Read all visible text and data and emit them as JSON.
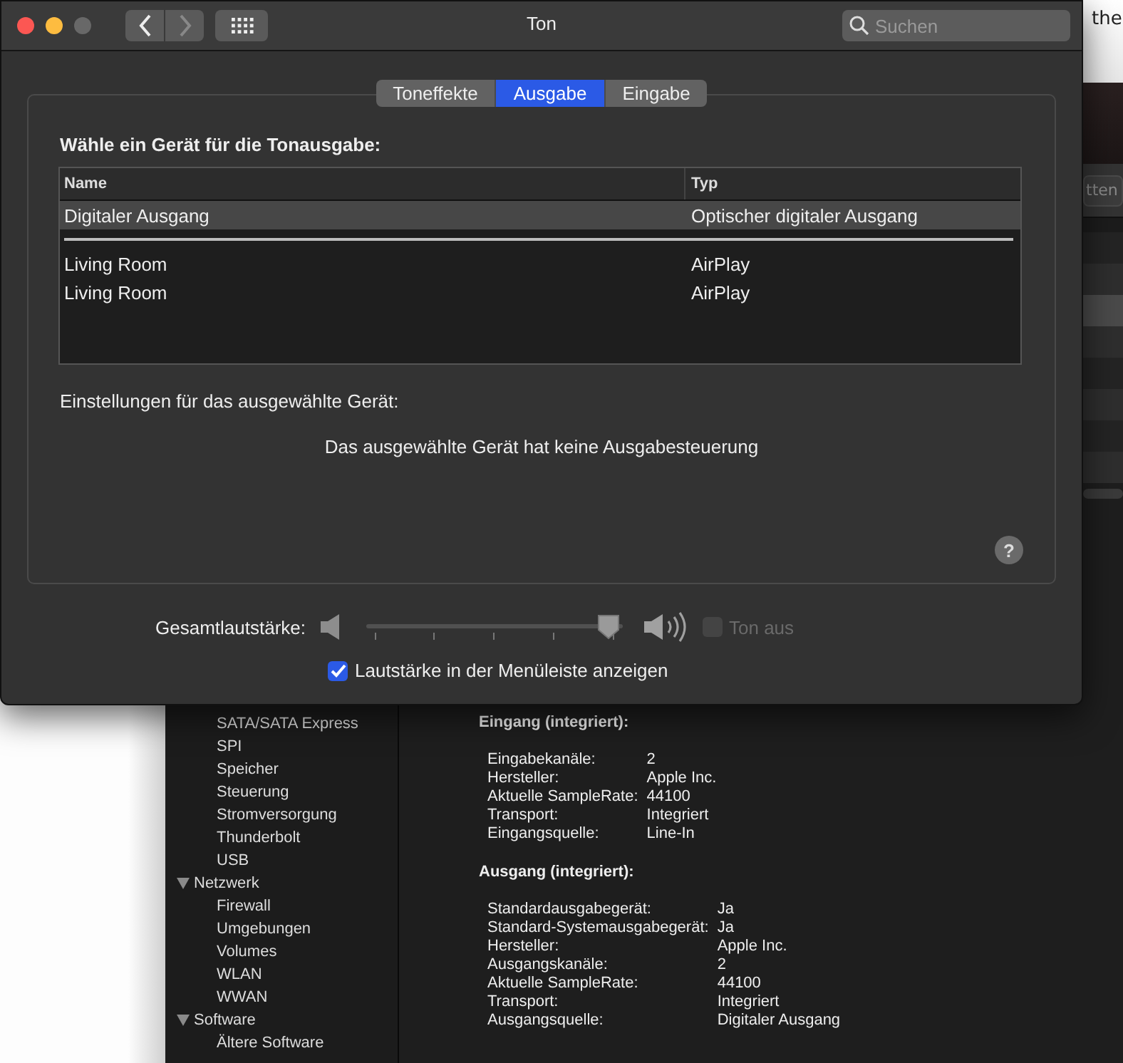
{
  "other_window": {
    "text": "the"
  },
  "background_window": {
    "toolbar_button": "tten",
    "sidebar": {
      "continued_items": [
        "SATA/SATA Express",
        "SPI",
        "Speicher",
        "Steuerung",
        "Stromversorgung",
        "Thunderbolt",
        "USB"
      ],
      "items": [
        {
          "label": "Netzwerk",
          "expanded": true,
          "children": [
            "Firewall",
            "Umgebungen",
            "Volumes",
            "WLAN",
            "WWAN"
          ]
        },
        {
          "label": "Software",
          "expanded": true,
          "children": [
            "Ältere Software"
          ]
        }
      ]
    },
    "details": [
      {
        "title": "Eingang (integriert):",
        "rows": [
          {
            "key": "Eingabekanäle:",
            "value": "2"
          },
          {
            "key": "Hersteller:",
            "value": "Apple Inc."
          },
          {
            "key": "Aktuelle SampleRate:",
            "value": "44100"
          },
          {
            "key": "Transport:",
            "value": "Integriert"
          },
          {
            "key": "Eingangsquelle:",
            "value": "Line-In"
          }
        ]
      },
      {
        "title": "Ausgang (integriert):",
        "rows": [
          {
            "key": "Standardausgabegerät:",
            "value": "Ja"
          },
          {
            "key": "Standard-Systemausgabegerät:",
            "value": "Ja"
          },
          {
            "key": "Hersteller:",
            "value": "Apple Inc."
          },
          {
            "key": "Ausgangskanäle:",
            "value": "2"
          },
          {
            "key": "Aktuelle SampleRate:",
            "value": "44100"
          },
          {
            "key": "Transport:",
            "value": "Integriert"
          },
          {
            "key": "Ausgangsquelle:",
            "value": "Digitaler Ausgang"
          }
        ]
      }
    ]
  },
  "window": {
    "title": "Ton",
    "search": {
      "placeholder": "Suchen"
    }
  },
  "tabs": [
    {
      "label": "Toneffekte",
      "selected": false
    },
    {
      "label": "Ausgabe",
      "selected": true
    },
    {
      "label": "Eingabe",
      "selected": false
    }
  ],
  "output": {
    "heading": "Wähle ein Gerät für die Tonausgabe:",
    "columns": [
      "Name",
      "Typ"
    ],
    "row_groups": [
      [
        {
          "name": "Digitaler Ausgang",
          "type": "Optischer digitaler Ausgang",
          "selected": true
        }
      ],
      [
        {
          "name": "Living Room",
          "type": "AirPlay",
          "selected": false
        },
        {
          "name": "Living Room",
          "type": "AirPlay",
          "selected": false
        }
      ]
    ],
    "settings_label": "Einstellungen für das ausgewählte Gerät:",
    "message": "Das ausgewählte Gerät hat keine Ausgabesteuerung",
    "help": "?"
  },
  "volume": {
    "label": "Gesamtlautstärke:",
    "level": 0.98,
    "mute": {
      "label": "Ton aus",
      "checked": false,
      "disabled": true
    }
  },
  "menu_bar_checkbox": {
    "label": "Lautstärke in der Menüleiste anzeigen",
    "checked": true
  }
}
